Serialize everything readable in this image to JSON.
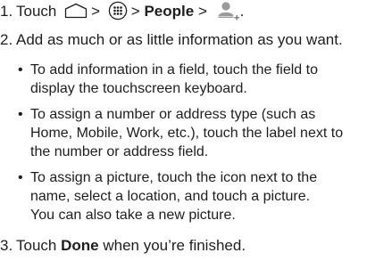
{
  "icons": {
    "home": "home-icon",
    "apps": "apps-icon",
    "add_contact": "add-contact-icon"
  },
  "steps": [
    {
      "number": "1.",
      "text_touch": "Touch",
      "sep1": ">",
      "sep2": ">",
      "people": "People",
      "sep3": ">",
      "end": "."
    },
    {
      "number": "2.",
      "text": "Add as much or as little information as you want."
    },
    {
      "number": "3.",
      "text_before": "Touch",
      "done": "Done",
      "text_after": "when you’re finished."
    }
  ],
  "bullets": [
    {
      "lines": [
        "To add information in a field, touch the field to",
        "display the touchscreen keyboard."
      ]
    },
    {
      "lines": [
        "To assign a number or address type (such as",
        "Home, Mobile, Work, etc.), touch the label next to",
        "the number or address field."
      ]
    },
    {
      "lines": [
        "To assign a picture, touch the icon next to the",
        "name, select a location, and touch a picture.",
        "You can also take a new picture."
      ]
    }
  ]
}
